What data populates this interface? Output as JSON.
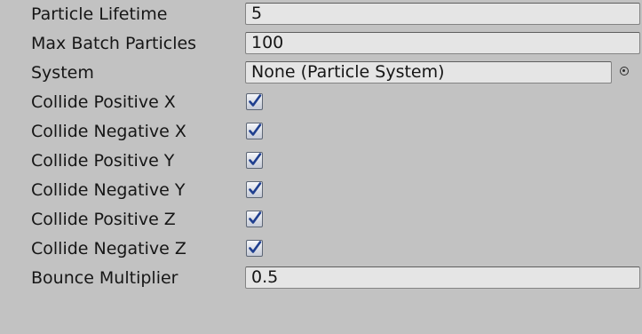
{
  "properties": {
    "particle_lifetime": {
      "label": "Particle Lifetime",
      "value": "5"
    },
    "max_batch_particles": {
      "label": "Max Batch Particles",
      "value": "100"
    },
    "system": {
      "label": "System",
      "value": "None (Particle System)",
      "picker_icon": "object-picker-icon"
    },
    "collide_positive_x": {
      "label": "Collide Positive X",
      "checked": true
    },
    "collide_negative_x": {
      "label": "Collide Negative X",
      "checked": true
    },
    "collide_positive_y": {
      "label": "Collide Positive Y",
      "checked": true
    },
    "collide_negative_y": {
      "label": "Collide Negative Y",
      "checked": true
    },
    "collide_positive_z": {
      "label": "Collide Positive Z",
      "checked": true
    },
    "collide_negative_z": {
      "label": "Collide Negative Z",
      "checked": true
    },
    "bounce_multiplier": {
      "label": "Bounce Multiplier",
      "value": "0.5"
    }
  },
  "colors": {
    "panel_background": "#c2c2c2",
    "field_background": "#e5e5e5",
    "checkmark": "#1f3f8f"
  }
}
